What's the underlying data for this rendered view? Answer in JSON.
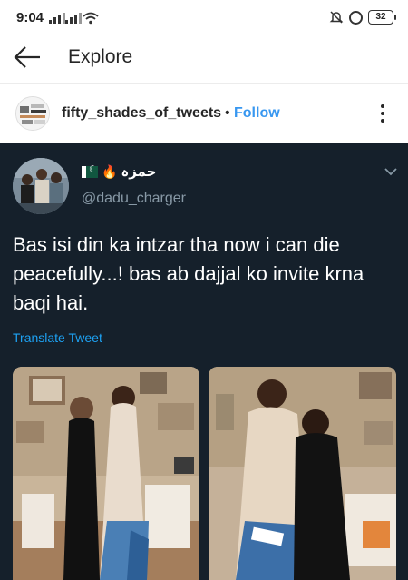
{
  "status_bar": {
    "time": "9:04",
    "battery": "32"
  },
  "header": {
    "title": "Explore"
  },
  "post": {
    "username": "fifty_shades_of_tweets",
    "separator": "•",
    "follow_label": "Follow"
  },
  "tweet": {
    "display_name": "حمزہ",
    "handle": "@dadu_charger",
    "text": "Bas isi din ka intzar tha now i can die peacefully...! bas ab dajjal ko invite krna baqi hai.",
    "translate_label": "Translate Tweet",
    "photos": [
      {
        "icon": "photo-two-women-studio"
      },
      {
        "icon": "photo-two-women-embrace"
      }
    ]
  },
  "colors": {
    "follow": "#3897f0",
    "tweet_bg": "#15202b",
    "tweet_link": "#1da1f2",
    "handle": "#8899a6"
  }
}
